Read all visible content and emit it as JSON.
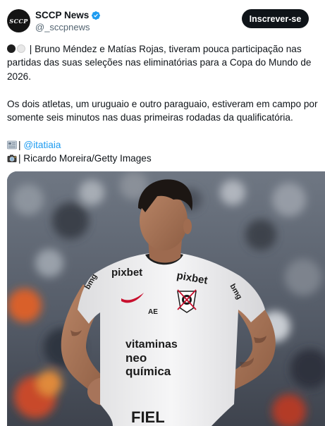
{
  "account": {
    "name": "SCCP News",
    "handle": "@_sccpnews",
    "avatar_text": "SCCP",
    "verified_icon": "verified-badge-icon"
  },
  "follow_button": {
    "label": "Inscrever-se"
  },
  "post": {
    "line1_text": "| Bruno Méndez e Matías Rojas, tiveram pouca participação nas partidas das suas seleções nas eliminatórias para a Copa do Mundo de 2026.",
    "line2_text": "Os dois atletas, um uruguaio e outro paraguaio, estiveram em campo por somente seis minutos nas duas primeiras rodadas da qualificatória.",
    "source_prefix": "| ",
    "source_mention": "@itatiaia",
    "photo_credit": "| Ricardo Moreira/Getty Images"
  },
  "photo": {
    "jersey_text": {
      "sponsor_left": "pixbet",
      "sponsor_right": "pixbet",
      "sleeve_left": "bmg",
      "sleeve_right": "bmg",
      "brand": "AE",
      "main_line1": "vitaminas",
      "main_line2": "neo",
      "main_line3": "química",
      "bottom": "FIEL"
    }
  },
  "colors": {
    "accent": "#1d9bf0",
    "button_bg": "#0f1419",
    "text": "#0f1419",
    "muted": "#536471"
  }
}
